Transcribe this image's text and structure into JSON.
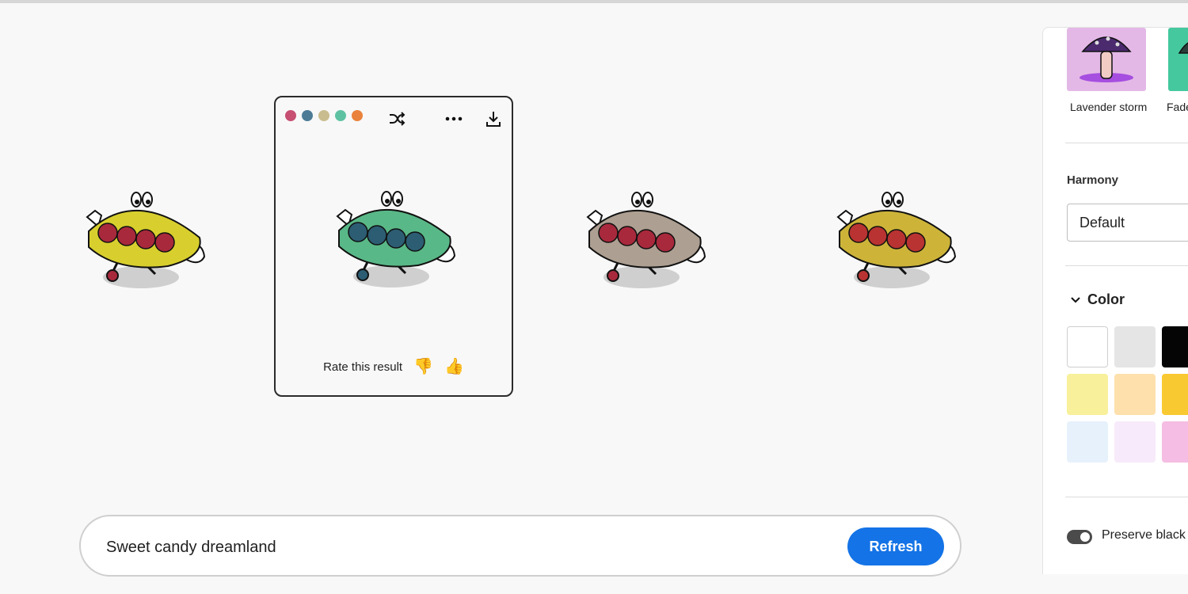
{
  "canvas": {
    "card": {
      "palette": [
        "#c64f72",
        "#4d7b96",
        "#c9bd8f",
        "#5ec2a2",
        "#e9823c"
      ],
      "shuffle_icon": "shuffle-icon",
      "more_icon": "more-icon",
      "download_icon": "download-icon",
      "rate_label": "Rate this result",
      "thumbs_down": "👎",
      "thumbs_up": "👍"
    },
    "variants": [
      {
        "body": "#d8cf2e",
        "fill": "#a8293c",
        "label": "variant-1"
      },
      {
        "body": "#59b887",
        "fill": "#2c5d73",
        "label": "variant-2"
      },
      {
        "body": "#ad9f91",
        "fill": "#a8293c",
        "label": "variant-3"
      },
      {
        "body": "#cdb439",
        "fill": "#b83331",
        "label": "variant-4"
      }
    ]
  },
  "prompt": {
    "value": "Sweet candy dreamland",
    "button_label": "Refresh"
  },
  "panel": {
    "presets": [
      {
        "label": "Lavender storm",
        "color": "#e3b8e6"
      },
      {
        "label": "Fade",
        "color": "#45c89e"
      }
    ],
    "harmony": {
      "label": "Harmony",
      "value": "Default"
    },
    "color": {
      "title": "Color",
      "swatches": [
        "#ffffff",
        "#e5e5e5",
        "#050505",
        "#f8f09a",
        "#fde0ac",
        "#f9c932",
        "#e6f1fc",
        "#f7eafa",
        "#f5bde3"
      ]
    },
    "preserve_label": "Preserve black a"
  }
}
